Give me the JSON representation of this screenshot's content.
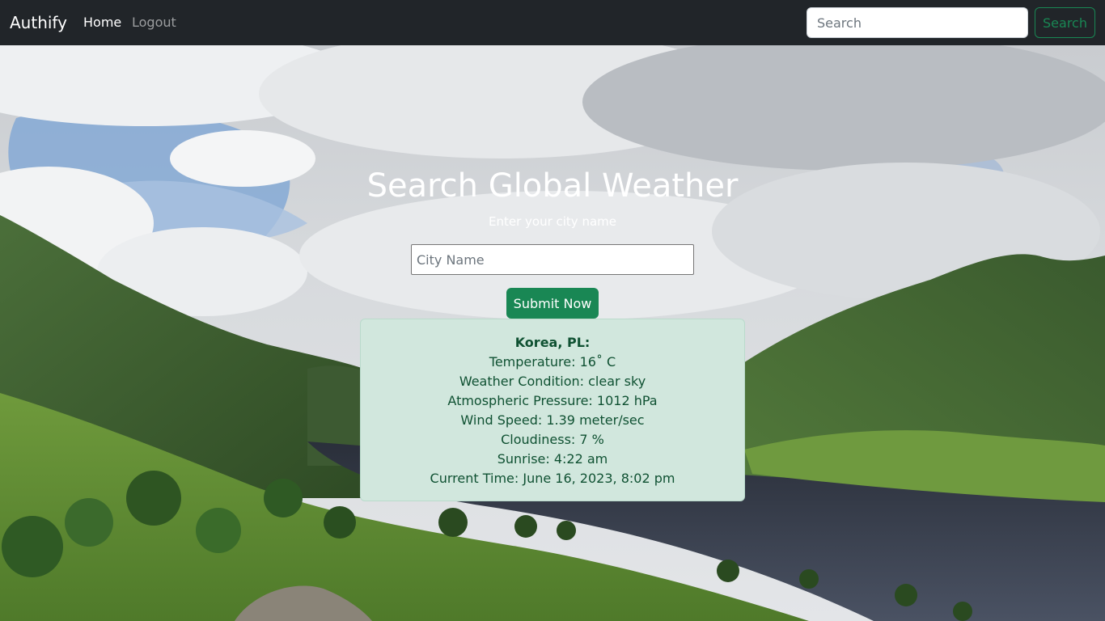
{
  "navbar": {
    "brand": "Authify",
    "links": [
      {
        "label": "Home",
        "active": true
      },
      {
        "label": "Logout",
        "active": false
      }
    ],
    "search": {
      "placeholder": "Search",
      "value": "",
      "button_label": "Search"
    }
  },
  "main": {
    "title": "Search Global Weather",
    "subtitle": "Enter your city name",
    "city_input": {
      "placeholder": "City Name",
      "value": ""
    },
    "submit_label": "Submit Now"
  },
  "weather": {
    "location": "Korea, PL:",
    "temperature": "Temperature: 16˚ C",
    "condition": "Weather Condition: clear sky",
    "pressure": "Atmospheric Pressure: 1012 hPa",
    "wind": "Wind Speed: 1.39 meter/sec",
    "cloudiness": "Cloudiness: 7 %",
    "sunrise": "Sunrise: 4:22 am",
    "current_time": "Current Time: June 16, 2023, 8:02 pm"
  },
  "colors": {
    "navbar_bg": "#212529",
    "accent": "#198754",
    "alert_bg": "#d1e7dd",
    "alert_text": "#0f5132"
  },
  "icons": {
    "background": "mountain-lake-landscape-image"
  }
}
